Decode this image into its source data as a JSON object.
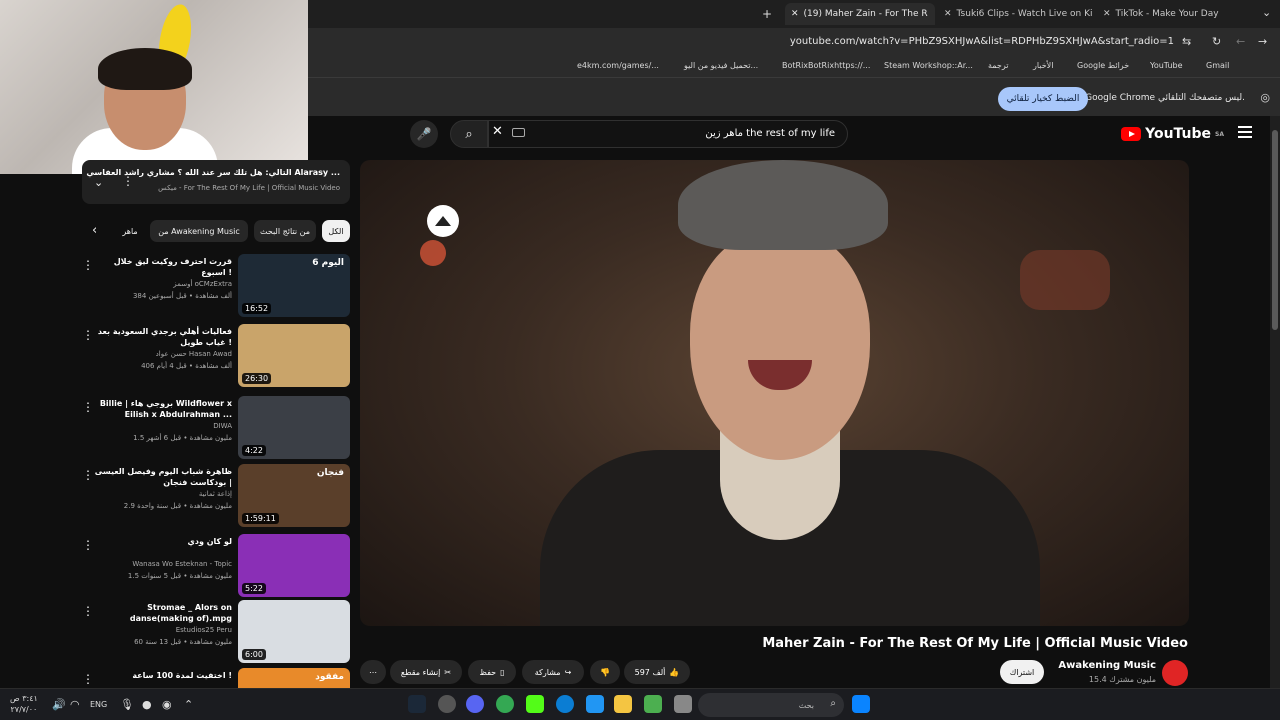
{
  "browser": {
    "tabs": [
      {
        "label": "(19) Maher Zain - For The R",
        "active": true
      },
      {
        "label": "Tsuki6 Clips - Watch Live on Ki",
        "active": false
      },
      {
        "label": "TikTok - Make Your Day",
        "active": false
      }
    ],
    "new_tab": "+",
    "url": "youtube.com/watch?v=PHbZ9SXHJwA&list=RDPHbZ9SXHJwA&start_radio=1",
    "bookmarks": [
      "e4km.com/games/...",
      "تحميل فيديو من اليو...",
      "BotRixBotRixhttps://...",
      "Steam Workshop::Ar...",
      "ترجمة",
      "الأخبار",
      "Google خرائط",
      "YouTube",
      "Gmail"
    ],
    "infobar_text": "Google Chrome ليس متصفحك التلقائي.",
    "infobar_button": "الضبط كخيار تلقائي"
  },
  "youtube": {
    "logo_text": "YouTube",
    "logo_region": "SA",
    "search_query": "ماهر زين the rest of my life",
    "next_box": {
      "title": "التالي: هل تلك سر عند الله ؟ مشاري راشد العفاسي Alarasy ...",
      "subtitle": "ميكس - For The Rest Of My Life | Official Music Video"
    },
    "chips": [
      "الكل",
      "من نتائج البحث",
      "من Awakening Music",
      "ماهر"
    ],
    "recommendations": [
      {
        "title": "قررت احترف روكيت ليق خلال اسبوع !",
        "channel": "أوسمز oCMzExtra",
        "meta": "384 ألف مشاهدة • قبل أسبوعين",
        "duration": "16:52",
        "thumb_text": "اليوم 6",
        "thumb_color": "#1e2a36"
      },
      {
        "title": "فعاليات أهلي برجدي السعودية بعد غياب طويل !",
        "channel": "حسن عواد Hasan Awad",
        "meta": "406 ألف مشاهدة • قبل 4 أيام",
        "duration": "26:30",
        "thumb_text": "",
        "thumb_color": "#c9a46a"
      },
      {
        "title": "Billie | بروجي هاء Wildflower x Eilish x Abdulrahman ...",
        "channel": "DIWA",
        "meta": "1.5 مليون مشاهدة • قبل 6 أشهر",
        "duration": "4:22",
        "thumb_text": "",
        "thumb_color": "#3b3f46"
      },
      {
        "title": "ظاهرة شباب اليوم وفيصل العيسى | بودكاست فنجان",
        "channel": "إذاعة ثمانية",
        "meta": "2.9 مليون مشاهدة • قبل سنة واحدة",
        "duration": "1:59:11",
        "thumb_text": "فنجان",
        "thumb_color": "#5a3f2a"
      },
      {
        "title": "لو كان ودي",
        "channel": "Wanasa Wo Esteknan - Topic",
        "meta": "1.5 مليون مشاهدة • قبل 5 سنوات",
        "duration": "5:22",
        "thumb_text": "",
        "thumb_color": "#8a2fb6"
      },
      {
        "title": "Stromae _ Alors on danse(making of).mpg",
        "channel": "Estudios25 Peru",
        "meta": "60 مليون مشاهدة • قبل 13 سنة",
        "duration": "6:00",
        "thumb_text": "",
        "thumb_color": "#d9dde2"
      },
      {
        "title": "اختفيت لمدة 100 ساعة !",
        "channel": "",
        "meta": "",
        "duration": "",
        "thumb_text": "مفقود",
        "thumb_color": "#e88a2a"
      }
    ],
    "video": {
      "title": "Maher Zain - For The Rest Of My Life | Official Music Video",
      "channel": "Awakening Music",
      "subscribers": "15.4 مليون مشترك",
      "subscribe_label": "اشتراك",
      "likes": "597 ألف",
      "share_label": "مشاركة",
      "save_label": "حفظ",
      "clip_label": "إنشاء مقطع"
    }
  },
  "taskbar": {
    "search_placeholder": "بحث",
    "language": "ENG",
    "time": "٣:٤١ ص",
    "date": "٢٧/٧/٠٠"
  }
}
